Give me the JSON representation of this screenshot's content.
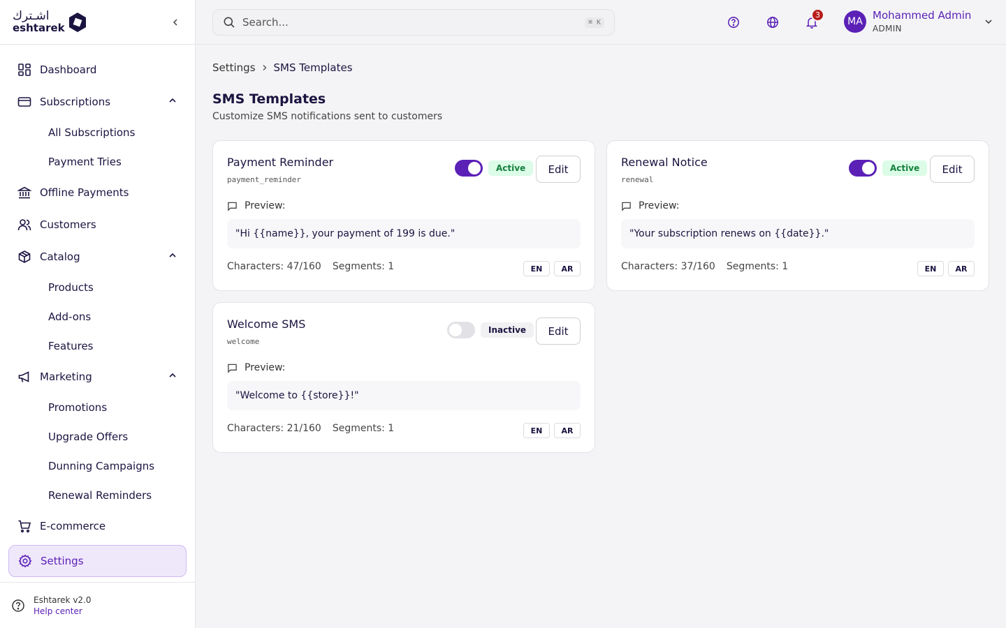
{
  "brand": {
    "name_ar": "اشـترك",
    "name_en": "eshtarek"
  },
  "sidebar": {
    "items": [
      {
        "label": "Dashboard"
      },
      {
        "label": "Subscriptions",
        "sub": [
          "All Subscriptions",
          "Payment Tries"
        ]
      },
      {
        "label": "Offline Payments"
      },
      {
        "label": "Customers"
      },
      {
        "label": "Catalog",
        "sub": [
          "Products",
          "Add-ons",
          "Features"
        ]
      },
      {
        "label": "Marketing",
        "sub": [
          "Promotions",
          "Upgrade Offers",
          "Dunning Campaigns",
          "Renewal Reminders"
        ]
      },
      {
        "label": "E-commerce"
      },
      {
        "label": "Settings"
      }
    ],
    "footer": {
      "version": "Eshtarek v2.0",
      "help": "Help center"
    }
  },
  "topbar": {
    "search_placeholder": "Search...",
    "search_shortcut": "⌘ K",
    "notification_count": "3",
    "user": {
      "initials": "MA",
      "name": "Mohammed Admin",
      "role": "ADMIN"
    }
  },
  "breadcrumb": {
    "parent": "Settings",
    "current": "SMS Templates"
  },
  "page": {
    "title": "SMS Templates",
    "subtitle": "Customize SMS notifications sent to customers"
  },
  "templates": [
    {
      "title": "Payment Reminder",
      "key": "payment_reminder",
      "enabled": true,
      "status": "Active",
      "edit": "Edit",
      "preview_label": "Preview:",
      "preview": "\"Hi {{name}}, your payment of 199 is due.\"",
      "characters": "Characters: 47/160",
      "segments": "Segments: 1",
      "langs": [
        "EN",
        "AR"
      ]
    },
    {
      "title": "Renewal Notice",
      "key": "renewal",
      "enabled": true,
      "status": "Active",
      "edit": "Edit",
      "preview_label": "Preview:",
      "preview": "\"Your subscription renews on {{date}}.\"",
      "characters": "Characters: 37/160",
      "segments": "Segments: 1",
      "langs": [
        "EN",
        "AR"
      ]
    },
    {
      "title": "Welcome SMS",
      "key": "welcome",
      "enabled": false,
      "status": "Inactive",
      "edit": "Edit",
      "preview_label": "Preview:",
      "preview": "\"Welcome to {{store}}!\"",
      "characters": "Characters: 21/160",
      "segments": "Segments: 1",
      "langs": [
        "EN",
        "AR"
      ]
    }
  ]
}
